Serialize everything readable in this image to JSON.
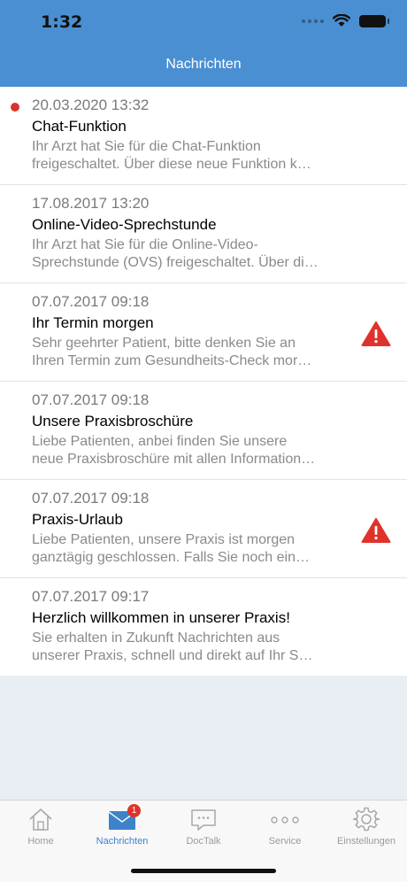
{
  "status": {
    "time": "1:32"
  },
  "header": {
    "title": "Nachrichten"
  },
  "messages": [
    {
      "date": "20.03.2020 13:32",
      "title": "Chat-Funktion",
      "preview_line1": "Ihr Arzt hat Sie für die Chat-Funktion",
      "preview_line2": "freigeschaltet. Über diese neue Funktion k…",
      "unread": true,
      "warning": false
    },
    {
      "date": "17.08.2017 13:20",
      "title": "Online-Video-Sprechstunde",
      "preview_line1": "Ihr Arzt hat Sie für die Online-Video-",
      "preview_line2": "Sprechstunde (OVS) freigeschaltet. Über di…",
      "unread": false,
      "warning": false
    },
    {
      "date": "07.07.2017 09:18",
      "title": "Ihr Termin morgen",
      "preview_line1": "Sehr geehrter Patient, bitte denken Sie an",
      "preview_line2": "Ihren Termin zum Gesundheits-Check mor…",
      "unread": false,
      "warning": true
    },
    {
      "date": "07.07.2017 09:18",
      "title": "Unsere Praxisbroschüre",
      "preview_line1": "Liebe Patienten, anbei finden Sie unsere",
      "preview_line2": "neue Praxisbroschüre mit allen Information…",
      "unread": false,
      "warning": false
    },
    {
      "date": "07.07.2017 09:18",
      "title": "Praxis-Urlaub",
      "preview_line1": "Liebe Patienten, unsere Praxis ist morgen",
      "preview_line2": "ganztägig geschlossen. Falls Sie noch ein…",
      "unread": false,
      "warning": true
    },
    {
      "date": "07.07.2017 09:17",
      "title": "Herzlich willkommen in unserer Praxis!",
      "preview_line1": "Sie erhalten in Zukunft Nachrichten aus",
      "preview_line2": "unserer Praxis, schnell und direkt auf Ihr S…",
      "unread": false,
      "warning": false
    }
  ],
  "tabbar": {
    "tabs": [
      {
        "label": "Home",
        "icon": "home-icon"
      },
      {
        "label": "Nachrichten",
        "icon": "envelope-icon",
        "badge": "1",
        "active": true
      },
      {
        "label": "DocTalk",
        "icon": "chat-icon"
      },
      {
        "label": "Service",
        "icon": "more-dots-icon"
      },
      {
        "label": "Einstellungen",
        "icon": "gear-icon"
      }
    ]
  },
  "colors": {
    "header_bg": "#4a8fd2",
    "accent": "#3d83c9",
    "unread_dot": "#d9332c",
    "warning": "#e0322b"
  }
}
